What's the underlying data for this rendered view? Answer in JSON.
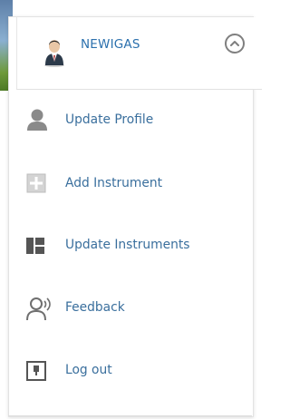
{
  "user": {
    "name": "NEWIGAS"
  },
  "menu": {
    "items": [
      {
        "label": "Update Profile",
        "icon": "user-silhouette-icon"
      },
      {
        "label": "Add Instrument",
        "icon": "add-square-icon"
      },
      {
        "label": "Update Instruments",
        "icon": "dashboard-tiles-icon"
      },
      {
        "label": "Feedback",
        "icon": "speaking-person-icon"
      },
      {
        "label": "Log out",
        "icon": "logout-box-icon"
      }
    ]
  },
  "colors": {
    "link": "#3a6f9d",
    "username": "#2b70ad",
    "icon": "#6f6f6f"
  }
}
